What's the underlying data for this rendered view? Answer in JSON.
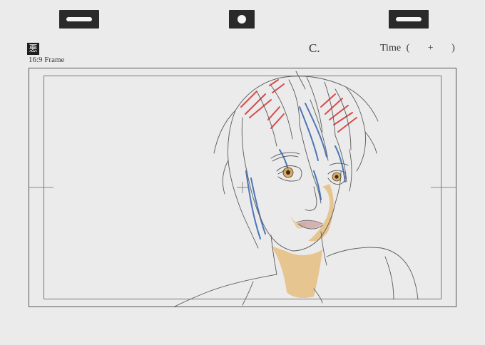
{
  "sheet": {
    "logo_glyph": "悪",
    "frame_label": "16:9 Frame",
    "cut_label": "C.",
    "time": {
      "label": "Time",
      "open": "(",
      "plus": "+",
      "close": ")"
    }
  },
  "colors": {
    "paper": "#ecebeb",
    "frame_line": "#555555",
    "pencil": "#5a5a5a",
    "hair_red": "#d84a4a",
    "hair_blue": "#4a76b8",
    "skin_shadow": "#e3a646",
    "lips": "#c99a9a"
  }
}
